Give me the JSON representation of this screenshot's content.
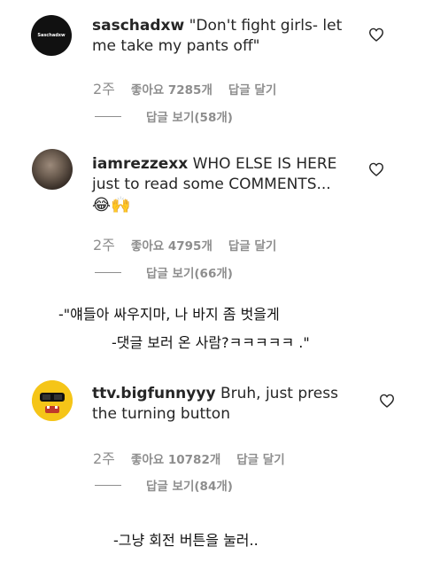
{
  "comments": [
    {
      "username": "saschadxw",
      "text": "\"Don't fight girls- let me take my pants off\"",
      "text_line1": "\"Don't fight girls- let",
      "text_line2": "me take my pants off\"",
      "time": "2주",
      "likes": "좋아요 7285개",
      "reply": "답글 달기",
      "replies": "답글 보기(58개)",
      "avatar_text": "Saschadxw"
    },
    {
      "username": "iamrezzexx",
      "text_line1": "WHO ELSE IS HERE",
      "text_line2": "just to read some COMMENTS...",
      "emoji": "😂🙌",
      "time": "2주",
      "likes": "좋아요 4795개",
      "reply": "답글 달기",
      "replies": "답글 보기(66개)"
    },
    {
      "username": "ttv.bigfunnyyy",
      "text_line1": "Bruh, just press",
      "text_line2": "the turning button",
      "time": "2주",
      "likes": "좋아요 10782개",
      "reply": "답글 달기",
      "replies": "답글 보기(84개)"
    }
  ],
  "captions": {
    "caption1": "-\"얘들아 싸우지마, 나 바지 좀 벗을게",
    "caption2": "-댓글 보러 온 사람?ㅋㅋㅋㅋㅋ   .\"",
    "caption3": "-그냥 회전 버튼을 눌러.."
  },
  "colors": {
    "text": "#262626",
    "meta": "#8e8e8e",
    "avatar3_bg": "#f5c518"
  },
  "icons": {
    "like": "heart-icon"
  }
}
